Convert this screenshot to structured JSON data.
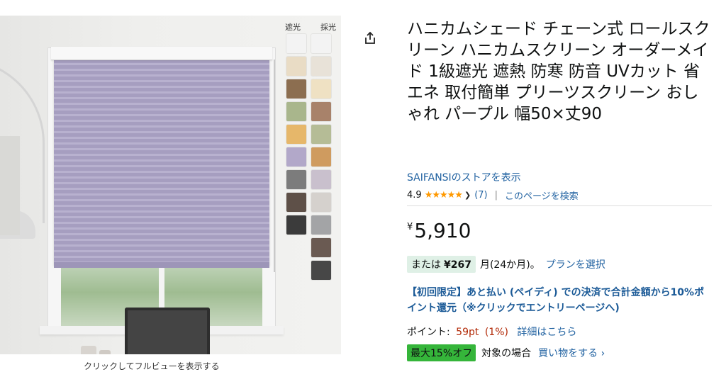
{
  "image_panel": {
    "swatch_headers": [
      "遮光",
      "採光"
    ],
    "swatches_blackout": [
      "#f3f3f3",
      "#e9dcc5",
      "#8c6e50",
      "#a9b68c",
      "#e6b76a",
      "#b2a8c9",
      "#7c7c7c",
      "#5e5048",
      "#3b3b3b"
    ],
    "swatches_light": [
      "#f3f3f3",
      "#e8e2d8",
      "#efe1c3",
      "#a8826a",
      "#b5bc96",
      "#cf9b5f",
      "#c9c0cd",
      "#d5d1cd",
      "#a3a4a6",
      "#6a5a52",
      "#474747"
    ],
    "caption": "クリックしてフルビューを表示する"
  },
  "share": {
    "icon": "share-icon"
  },
  "product": {
    "title": "ハニカムシェード チェーン式 ロールスクリーン ハニカムスクリーン オーダーメイド 1級遮光 遮熱 防寒 防音 UVカット 省エネ 取付簡単 プリーツスクリーン おしゃれ パープル 幅50×丈90",
    "store_link": "SAIFANSIのストアを表示",
    "rating": "4.9",
    "rating_count": "(7)",
    "search_page": "このページを検索"
  },
  "price": {
    "symbol": "¥",
    "value": "5,910"
  },
  "installment": {
    "prefix": "または",
    "amount": "¥267",
    "term": "月(24か月)。",
    "link": "プランを選択"
  },
  "promo_text": "【初回限定】あと払い (ペイディ) での決済で合計金額から10%ポイント還元（※クリックでエントリーページへ)",
  "points": {
    "label": "ポイント:",
    "value": "59pt",
    "percent": "(1%)",
    "link": "詳細はこちら"
  },
  "deal": {
    "badge": "最大15%オフ",
    "condition": "対象の場合",
    "link": "買い物をする ›"
  },
  "colors": {
    "link": "#2162a1",
    "price_red": "#b12704",
    "star": "#ff9900",
    "deal_green": "#35b53a",
    "installment_bg": "#dff0e6"
  }
}
